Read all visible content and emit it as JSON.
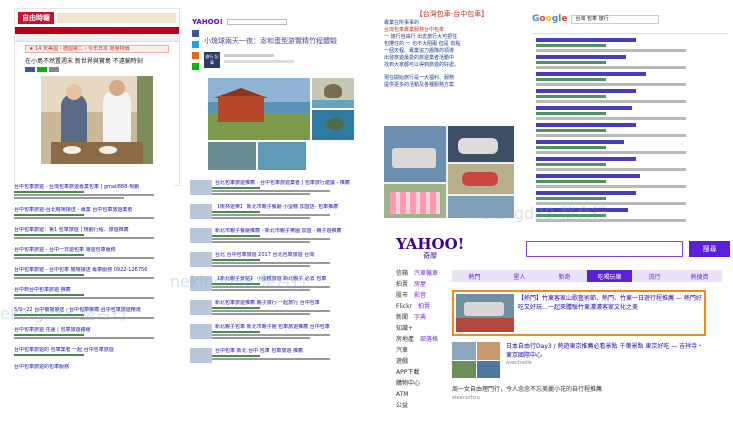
{
  "panel_news": {
    "logo": "自由時報",
    "alert": "★ 14 天美國・德國第二・今年日本 限量特價",
    "headline": "在小島不然置週末 新世界與寶島 不遠輸時刻"
  },
  "panel_yahoo_blog": {
    "logo": "YAHOO!",
    "title": "小琉球兩天一夜：澎和蛋型游覽精竹程體驗",
    "badge": "旅行 記事"
  },
  "panel_info": {
    "title": "【台灣包車-台中包車】",
    "text_lines": [
      "專業在所事事的",
      "台灣包車專業服務台中包車",
      "ー 旅行自由行 出去旅行大可把住",
      "包攬住的 ー 也不大阻礙 但是 有點",
      "一個天程、專業協力團隊的領導",
      "出發旅遊最愛的旅遊業者活動中",
      "找到大家都可以得到旅遊的好處。"
    ],
    "text_lines_2": [
      "現在開始旅行是一大福利、服務",
      "提供更多的活動及各種服務方案"
    ]
  },
  "panel_google": {
    "search_value": "台灣 包車 旅行"
  },
  "panel_results": {
    "items": [
      "台中包車旅遊 - 台灣包車旅遊專業包車 | gmail888-規劃",
      "台中包車旅遊-台北機場接送 - 專業 台中包車旅遊業者",
      "台中包車旅遊：第1 包車旅遊 | 規劃行程、旅遊推薦",
      "台中包車旅遊 - 台中一日遊包車 導遊包車服務",
      "台中包車旅遊 - 台中包車 機場接送 專車服務 0922-126756",
      "台中到台中包車旅遊 推薦",
      "5/9~22 台中機場接送 - 台中包車推薦 台中包車旅遊精選",
      "台中包車旅遊 花蓮 | 包車旅遊路線",
      "台中包車旅遊的 包車業者 一起 台中包車旅遊",
      "台中包車旅遊的包車服務"
    ]
  },
  "panel_blog": {
    "items": [
      "台北包車旅遊推薦 - 台中包車旅遊業者 | 包車旅行建議 - 推薦",
      "【桃林遊樂】 新北市親子餐廳 小蛋糕 加盟店- 包車推薦",
      "新北市親子餐廳推薦 - 新北市親子樂園 加盟 - 親子遊推薦",
      "台北 台中包車旅遊 2017 台北包車旅遊 台灣",
      "【新北親子景點】 小蛋糕旅遊 新北親子 必去 包車",
      "新北包車旅遊推薦 親子旅行 一起旅行 台中包車",
      "新北親子包車 新北市親子館 包車旅遊推薦 台中包車",
      "台中包車 新北 台中 包車 包車旅遊 推薦"
    ]
  },
  "panel_yahoo_tw": {
    "logo": "YAHOO!",
    "logo_sub": "奇摩",
    "search_button": "搜尋",
    "tabs": [
      "熱門",
      "星人",
      "新奇",
      "吃喝玩樂",
      "流行",
      "熱搜資"
    ],
    "left_menu": [
      "信箱",
      "拍賣",
      "股市",
      "Flickr",
      "新聞",
      "知識+",
      "房地產",
      "汽車",
      "遊戲",
      "APP下載",
      "購物中心",
      "ATM",
      "公益"
    ],
    "left_menu_right": [
      "汽車機車",
      "房屋",
      "影音",
      "拍賣",
      "字典",
      "",
      "部落格"
    ],
    "feature_title": "【熱門】竹東客家山歌藝術節、熱門、竹東一日遊行程推薦 — 熱門好吃又好玩…一起來體驗竹東濃濃客家文化之美",
    "item2_text": "日本自由行Day3 / 熱遊東京推薦必看景點 千葉景點 東京好吃 — 吉祥寺・東京國際中心",
    "item2_src": "avectoelle",
    "item3_text": "周一女自由理門行，今人念念不忘美麗小花的自行程推薦",
    "item3_src": "eleanorhsu"
  },
  "watermark": "nekingd88 整合行"
}
